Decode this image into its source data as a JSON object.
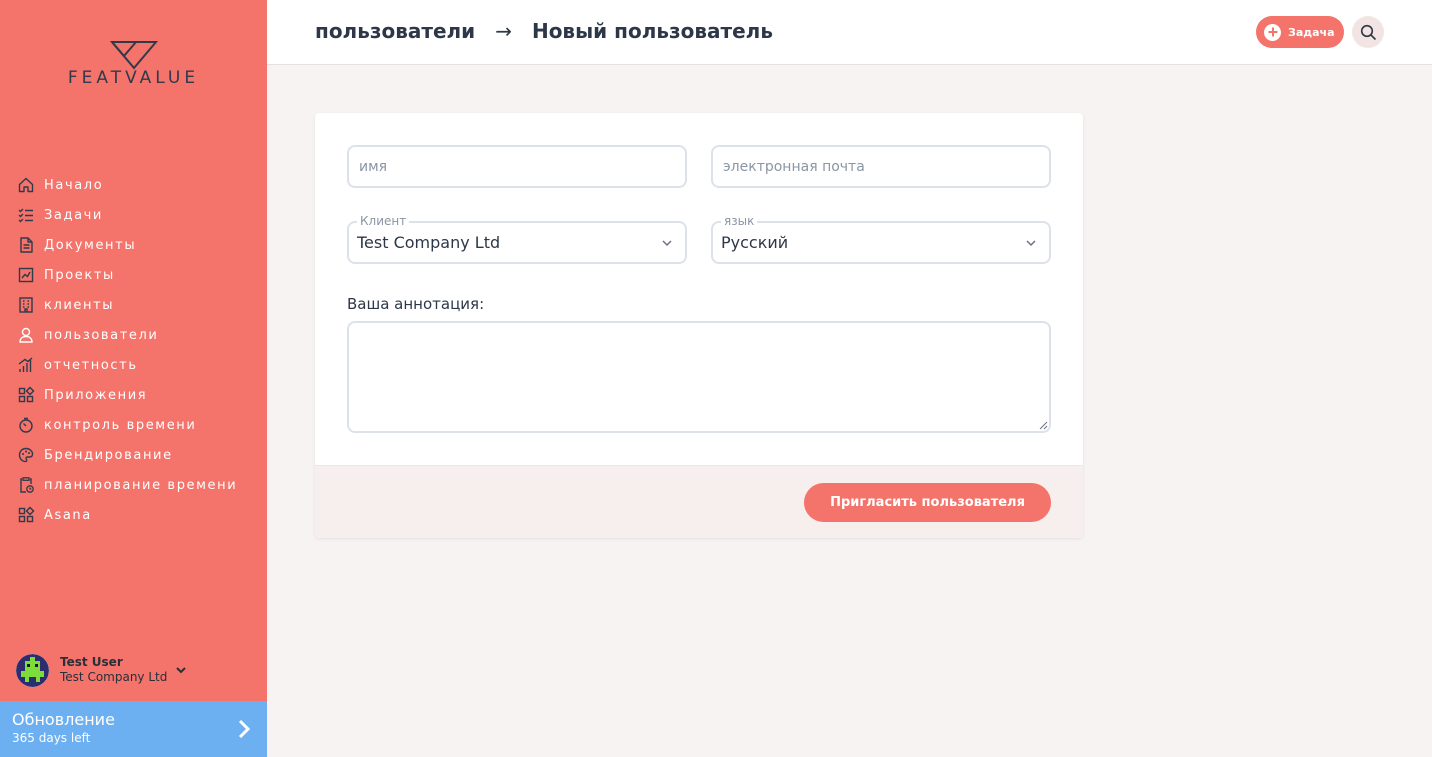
{
  "brand": {
    "name": "FEATVALUE",
    "accent": "#f4736a",
    "upgrade_color": "#6db0f2"
  },
  "sidebar": {
    "items": [
      {
        "label": "Начало",
        "icon": "home-icon"
      },
      {
        "label": "Задачи",
        "icon": "checklist-icon"
      },
      {
        "label": "Документы",
        "icon": "document-icon"
      },
      {
        "label": "Проекты",
        "icon": "chart-board-icon"
      },
      {
        "label": "клиенты",
        "icon": "building-icon"
      },
      {
        "label": "пользователи",
        "icon": "user-icon"
      },
      {
        "label": "отчетность",
        "icon": "bar-chart-icon"
      },
      {
        "label": "Приложения",
        "icon": "apps-grid-icon"
      },
      {
        "label": "контроль времени",
        "icon": "timer-icon"
      },
      {
        "label": "Брендирование",
        "icon": "palette-icon"
      },
      {
        "label": "планирование времени",
        "icon": "clipboard-clock-icon"
      },
      {
        "label": "Asana",
        "icon": "apps-grid-icon"
      }
    ],
    "user": {
      "name": "Test User",
      "company": "Test Company Ltd"
    },
    "upgrade": {
      "title": "Обновление",
      "subtitle": "365 days left"
    }
  },
  "header": {
    "breadcrumb_parent": "пользователи",
    "breadcrumb_separator": "→",
    "breadcrumb_current": "Новый пользователь",
    "task_button": "Задача"
  },
  "form": {
    "name_placeholder": "имя",
    "email_placeholder": "электронная почта",
    "client_label": "Клиент",
    "client_value": "Test Company Ltd",
    "language_label": "язык",
    "language_value": "Русский",
    "annotation_label": "Ваша аннотация:",
    "annotation_value": "",
    "submit_label": "Пригласить пользователя"
  }
}
